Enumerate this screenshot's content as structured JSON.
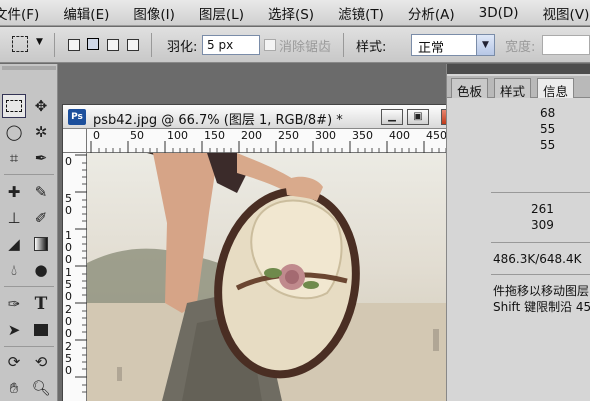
{
  "menubar": {
    "items": [
      "文件(F)",
      "编辑(E)",
      "图像(I)",
      "图层(L)",
      "选择(S)",
      "滤镜(T)",
      "分析(A)",
      "3D(D)",
      "视图(V)"
    ]
  },
  "options": {
    "feather_label": "羽化:",
    "feather_value": "5 px",
    "antialias_label": "消除锯齿",
    "style_label": "样式:",
    "style_value": "正常",
    "width_label": "宽度:"
  },
  "document": {
    "badge": "Ps",
    "title": "psb42.jpg @ 66.7% (图层 1, RGB/8#) *",
    "ruler_h": [
      "0",
      "50",
      "100",
      "150",
      "200",
      "250",
      "300",
      "350",
      "400",
      "450"
    ],
    "ruler_v": [
      "0",
      "5 0",
      "1 0 0",
      "1 5 0",
      "2 0 0",
      "2 5 0"
    ]
  },
  "panel": {
    "tabs": [
      "色板",
      "样式",
      "信息"
    ],
    "values": [
      "68",
      "55",
      "55",
      "261",
      "309",
      "486.3K/648.4K",
      "件拖移以移动图层",
      "Shift 键限制沿 45"
    ]
  },
  "icons": [
    "move-icon",
    "marquee-icon",
    "lasso-icon",
    "magic-wand-icon",
    "crop-icon",
    "eyedropper-icon",
    "healing-brush-icon",
    "brush-icon",
    "clone-stamp-icon",
    "history-brush-icon",
    "eraser-icon",
    "gradient-icon",
    "blur-icon",
    "dodge-icon",
    "pen-icon",
    "type-icon",
    "path-select-icon",
    "shape-icon",
    "3d-rotate-icon",
    "3d-orbit-icon",
    "hand-icon",
    "zoom-icon"
  ]
}
